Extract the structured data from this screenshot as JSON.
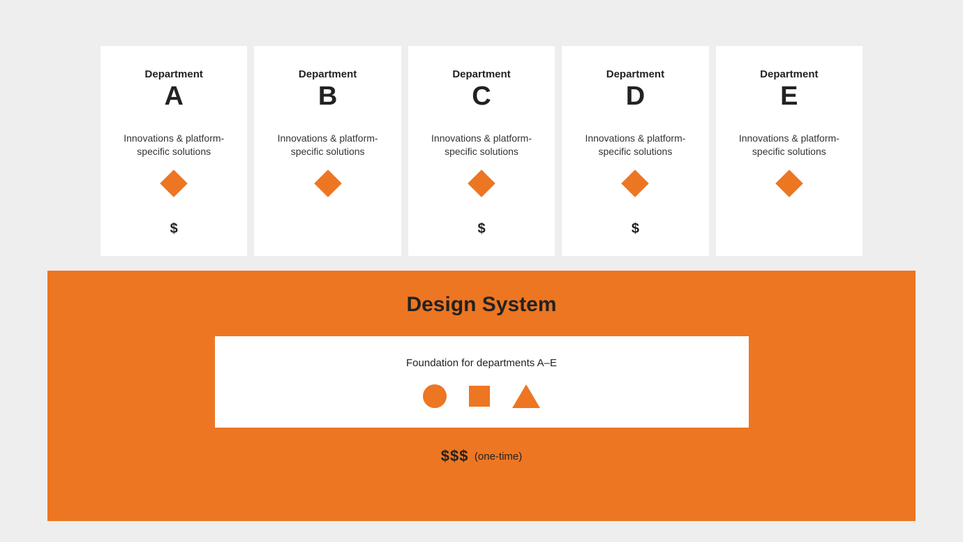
{
  "colors": {
    "accent": "#ed7622",
    "card_bg": "#ffffff",
    "page_bg": "#eeeeee",
    "text": "#222222"
  },
  "departments": [
    {
      "label": "Department",
      "letter": "A",
      "desc": "Innovations & platform-specific solutions",
      "icon": "diamond",
      "cost": "$"
    },
    {
      "label": "Department",
      "letter": "B",
      "desc": "Innovations & platform-specific solutions",
      "icon": "diamond",
      "cost": ""
    },
    {
      "label": "Department",
      "letter": "C",
      "desc": "Innovations & platform-specific solutions",
      "icon": "diamond",
      "cost": "$"
    },
    {
      "label": "Department",
      "letter": "D",
      "desc": "Innovations & platform-specific solutions",
      "icon": "diamond",
      "cost": "$"
    },
    {
      "label": "Department",
      "letter": "E",
      "desc": "Innovations & platform-specific solutions",
      "icon": "diamond",
      "cost": ""
    }
  ],
  "design_system": {
    "title": "Design System",
    "subtitle": "Foundation for departments A–E",
    "shapes": [
      "circle",
      "square",
      "triangle"
    ],
    "cost_symbol": "$$$",
    "cost_note": "(one-time)"
  }
}
